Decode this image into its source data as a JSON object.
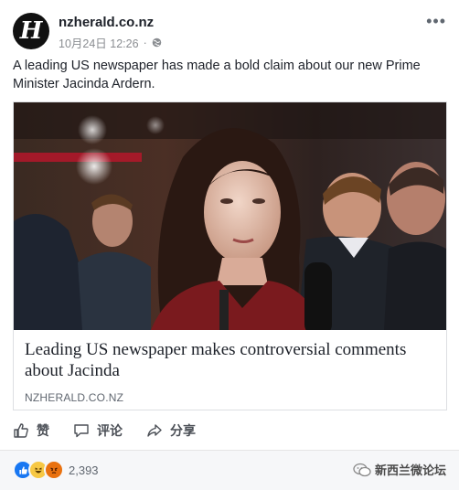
{
  "post": {
    "page_name": "nzherald.co.nz",
    "timestamp": "10月24日 12:26",
    "separator": "·",
    "avatar_letter": "H",
    "text": "A leading US newspaper has made a bold claim about our new Prime Minister Jacinda Ardern."
  },
  "link_preview": {
    "title": "Leading US newspaper makes controversial comments about Jacinda",
    "domain": "NZHERALD.CO.NZ"
  },
  "actions": {
    "like_label": "赞",
    "comment_label": "评论",
    "share_label": "分享"
  },
  "reactions": {
    "count": "2,393",
    "types": [
      "like-icon",
      "haha-icon",
      "angry-icon"
    ]
  },
  "watermark": {
    "text": "新西兰微论坛"
  },
  "colors": {
    "like_blue": "#1877f2",
    "haha_yellow": "#f7c844",
    "angry_orange": "#e9710f",
    "text_dark": "#1d2129",
    "text_meta": "#606770"
  }
}
